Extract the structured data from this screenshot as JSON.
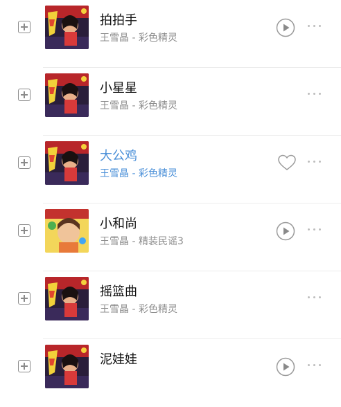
{
  "songs": [
    {
      "title": "拍拍手",
      "subtitle": "王雪晶 - 彩色精灵",
      "cover": "album-cover-caise",
      "action_icon": "play-icon",
      "active": false
    },
    {
      "title": "小星星",
      "subtitle": "王雪晶 - 彩色精灵",
      "cover": "album-cover-caise",
      "action_icon": "",
      "active": false
    },
    {
      "title": "大公鸡",
      "subtitle": "王雪晶 - 彩色精灵",
      "cover": "album-cover-caise",
      "action_icon": "heart-icon",
      "active": true
    },
    {
      "title": "小和尚",
      "subtitle": "王雪晶 - 精装民谣3",
      "cover": "album-cover-minyao",
      "action_icon": "play-icon",
      "active": false
    },
    {
      "title": "摇篮曲",
      "subtitle": "王雪晶 - 彩色精灵",
      "cover": "album-cover-caise",
      "action_icon": "",
      "active": false
    },
    {
      "title": "泥娃娃",
      "subtitle": "",
      "cover": "album-cover-caise",
      "action_icon": "play-icon",
      "active": false
    }
  ],
  "colors": {
    "active_text": "#4a8fd8",
    "title_text": "#111111",
    "subtitle_text": "#8c8c8c",
    "icon_gray": "#bdbdbd"
  }
}
